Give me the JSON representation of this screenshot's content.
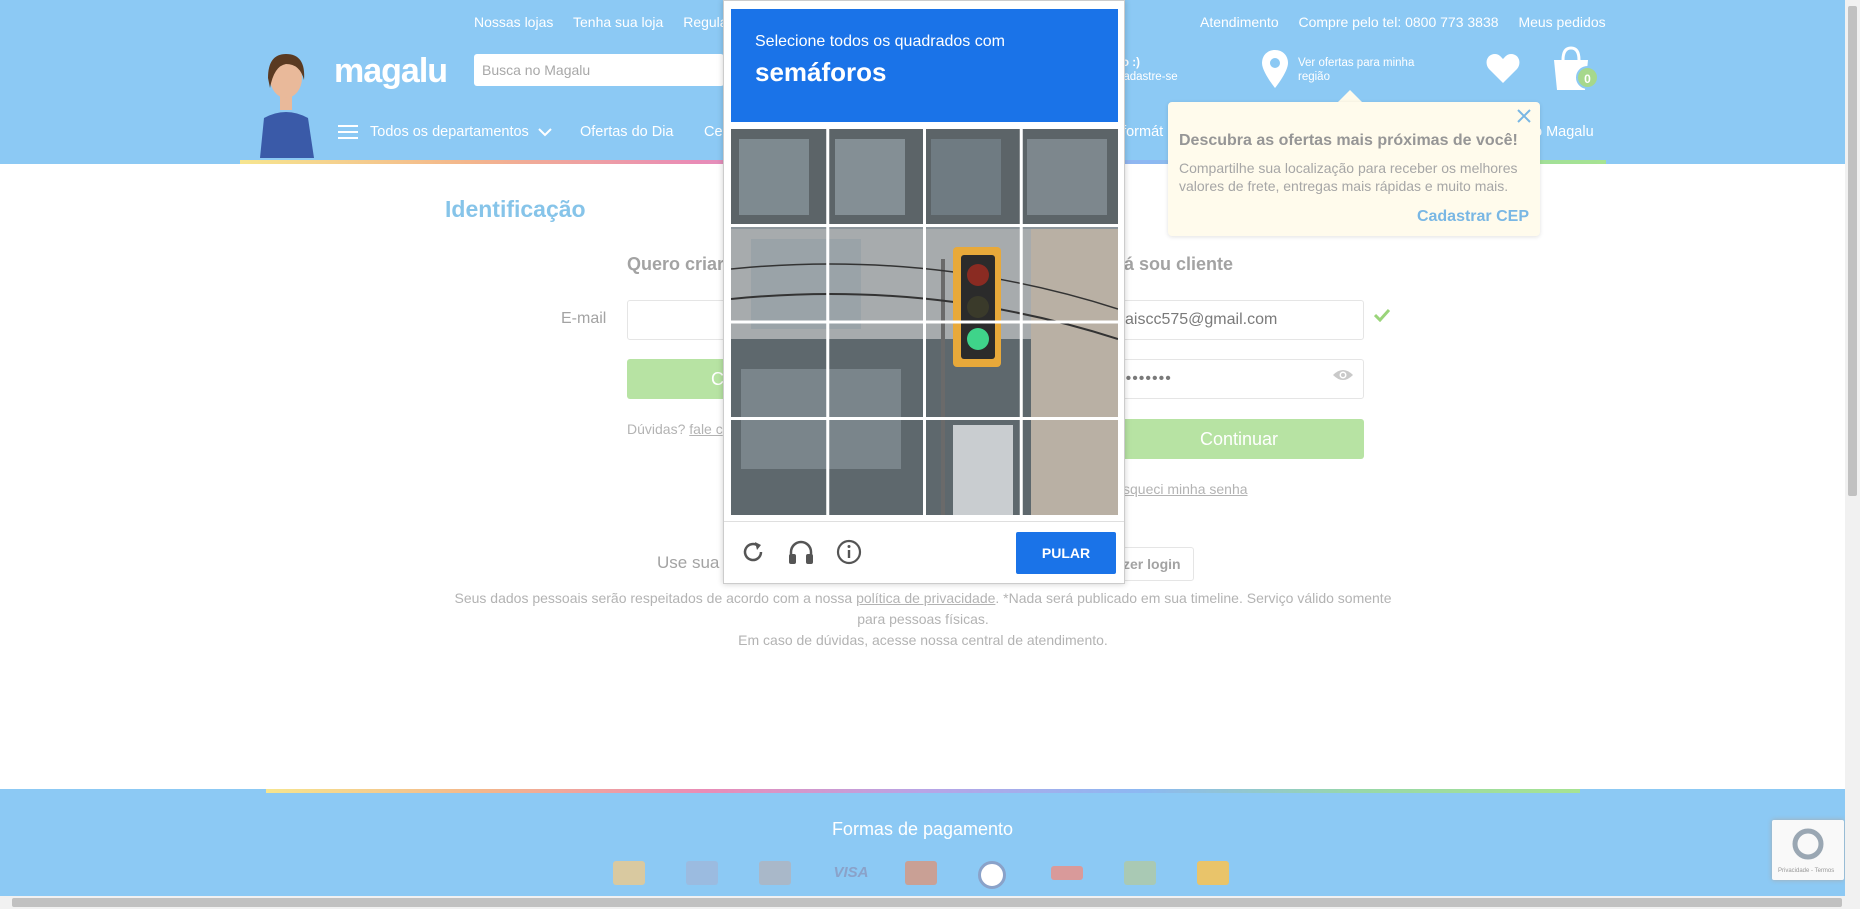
{
  "topbar": {
    "left": [
      "Nossas lojas",
      "Tenha sua loja",
      "Regular"
    ],
    "right": [
      "Atendimento",
      "Compre pelo tel: 0800 773 3838",
      "Meus pedidos"
    ]
  },
  "header": {
    "logo": "magalu",
    "search_placeholder": "Busca no Magalu",
    "greeting_line1": "ndo :)",
    "greeting_line2": "u cadastre-se",
    "region_text": "Ver ofertas para minha região",
    "cart_count": "0"
  },
  "nav": {
    "all_departments": "Todos os departamentos",
    "items": [
      "Ofertas do Dia",
      "Ce",
      "nformát",
      "o Magalu"
    ]
  },
  "main": {
    "page_title": "Identificação",
    "create": {
      "title": "Quero criar",
      "email_label": "E-mail",
      "button_label": "C",
      "help_prefix": "Dúvidas?",
      "help_link": "fale c"
    },
    "login": {
      "title": "á sou cliente",
      "email_value": "aiscc575@gmail.com",
      "password_value": "••••••••",
      "continue_label": "Continuar",
      "forgot_link": "squeci minha senha"
    },
    "social_text": "Use sua r",
    "social_button": "zer login",
    "legal_prefix": "Seus dados pessoais serão respeitados de acordo com a nossa",
    "legal_link": "política de privacidade",
    "legal_suffix": ". *Nada será publicado em sua timeline. Serviço válido somente para pessoas físicas.",
    "legal_line2": "Em caso de dúvidas, acesse nossa central de atendimento."
  },
  "location_popup": {
    "title": "Descubra as ofertas mais próximas de você!",
    "text": "Compartilhe sua localização para receber os melhores valores de frete, entregas mais rápidas e muito mais.",
    "link": "Cadastrar CEP"
  },
  "footer": {
    "title": "Formas de pagamento",
    "payment_icons": [
      "card-icon",
      "amex-icon",
      "boleto-icon",
      "visa-icon",
      "mastercard-icon",
      "diners-icon",
      "hipercard-icon",
      "elo-icon",
      "aura-icon"
    ]
  },
  "captcha": {
    "instruction": "Selecione todos os quadrados com",
    "target": "semáforos",
    "skip_label": "PULAR"
  },
  "recaptcha_badge": "Privacidade - Termos",
  "colors": {
    "header_bg": "#8cc9f4",
    "captcha_blue": "#1a73e8",
    "button_green": "#b7e3a3",
    "title_blue": "#86c4e9"
  }
}
